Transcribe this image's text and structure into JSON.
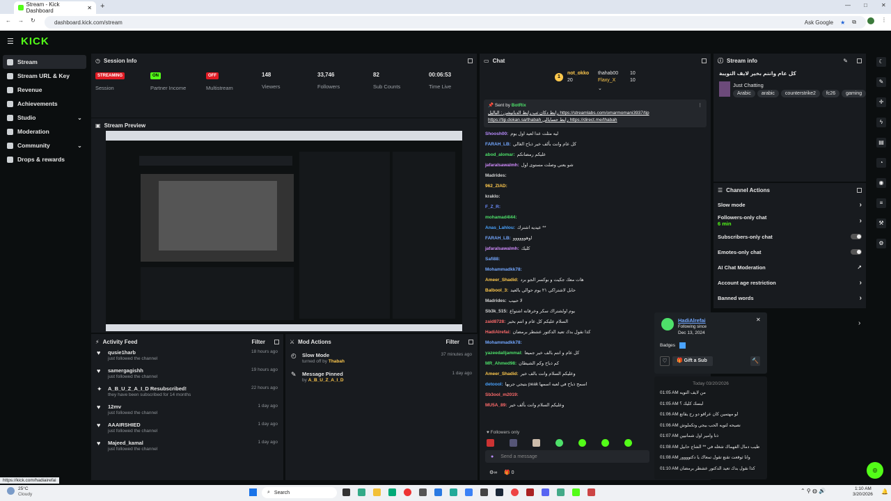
{
  "browser": {
    "tab_title": "Stream - Kick Dashboard",
    "url": "dashboard.kick.com/stream",
    "ask_google": "Ask Google"
  },
  "logo": "KICK",
  "sidebar": {
    "items": [
      {
        "label": "Stream"
      },
      {
        "label": "Stream URL & Key"
      },
      {
        "label": "Revenue"
      },
      {
        "label": "Achievements"
      },
      {
        "label": "Studio"
      },
      {
        "label": "Moderation"
      },
      {
        "label": "Community"
      },
      {
        "label": "Drops & rewards"
      }
    ]
  },
  "session": {
    "title": "Session Info",
    "cells": [
      {
        "pill": "STREAMING",
        "label": "Session"
      },
      {
        "pill": "ON",
        "label": "Partner Income"
      },
      {
        "pill": "OFF",
        "label": "Multistream"
      },
      {
        "num": "148",
        "label": "Viewers"
      },
      {
        "num": "33,746",
        "label": "Followers"
      },
      {
        "num": "82",
        "label": "Sub Counts"
      },
      {
        "num": "00:06:53",
        "label": "Time Live"
      }
    ]
  },
  "preview": {
    "title": "Stream Preview"
  },
  "activity": {
    "title": "Activity Feed",
    "filter": "Filter",
    "items": [
      {
        "user": "qusie1harb",
        "desc": "just followed the channel",
        "time": "18 hours ago"
      },
      {
        "user": "samergagishh",
        "desc": "just followed the channel",
        "time": "19 hours ago"
      },
      {
        "user": "A_B_U_Z_A_I_D Resubscribed!",
        "desc": "they have been subscribed for 14 months",
        "time": "22 hours ago"
      },
      {
        "user": "12mv",
        "desc": "just followed the channel",
        "time": "1 day ago"
      },
      {
        "user": "AAAIRSHIED",
        "desc": "just followed the channel",
        "time": "1 day ago"
      },
      {
        "user": "Majeed_kamal",
        "desc": "just followed the channel",
        "time": "1 day ago"
      }
    ]
  },
  "mod": {
    "title": "Mod Actions",
    "filter": "Filter",
    "items": [
      {
        "title": "Slow Mode",
        "desc": "turned off by",
        "by": "Thabah",
        "time": "37 minutes ago"
      },
      {
        "title": "Message Pinned",
        "desc": "by",
        "by": "A_B_U_Z_A_I_D",
        "time": "1 day ago"
      }
    ]
  },
  "chat": {
    "title": "Chat",
    "top": [
      {
        "name": "not_okko",
        "count": "20"
      },
      {
        "name": "thahab00",
        "count": "10"
      },
      {
        "name": "Flaxy_X",
        "count": "10"
      }
    ],
    "pinned": {
      "by": "Sent by",
      "bot": "BotRix",
      "text": "رابط دكان ثب رابط الدبانيشن : الباليل https://streamlabs.com/omarmomani3937/tip https://tip.dokan.sa/thabah رابط حسابالي https://direct.me/thabah"
    },
    "messages": [
      {
        "u": "Shoosh00:",
        "t": "ليه مثلت عدا لعيد اول يوم",
        "c": "#b98cff"
      },
      {
        "u": "FARAH_LB:",
        "t": "كل عام وانت بألف خير ذباح الغالي",
        "c": "#73a7ff"
      },
      {
        "u": "abod_alomar:",
        "t": "عليكم رمضانكم",
        "c": "#4ee06a"
      },
      {
        "u": "jafaralsawalmh:",
        "t": "شو يعني وصلت مستوى اول",
        "c": "#d28cff"
      },
      {
        "u": "Madrides:",
        "t": "",
        "c": "#d6d6d6"
      },
      {
        "u": "962_ZIAD:",
        "t": "",
        "c": "#ffc94d"
      },
      {
        "u": "kraklo:",
        "t": "",
        "c": "#d6d6d6"
      },
      {
        "u": "F_Z_R:",
        "t": "",
        "c": "#6c8dff"
      },
      {
        "u": "mohamad4l44:",
        "t": "",
        "c": "#4ee06a"
      },
      {
        "u": "Anas_Lahlou:",
        "t": "عيديه اشترك **",
        "c": "#4aa3ff"
      },
      {
        "u": "FARAH_LB:",
        "t": "اوهوووووو",
        "c": "#73a7ff"
      },
      {
        "u": "jafaralsawalmh:",
        "t": "كليك",
        "c": "#d28cff"
      },
      {
        "u": "Safi88:",
        "t": "",
        "c": "#73a7ff"
      },
      {
        "u": "Mohammadkk78:",
        "t": "",
        "c": "#73a7ff"
      },
      {
        "u": "Ameer_Shadid:",
        "t": "هات معك جكيت و بوكسر الجو برد",
        "c": "#ffc94d"
      },
      {
        "u": "Balbool_3:",
        "t": "حابل لاشتراكي ٢١ يوم حوالي بالعيد",
        "c": "#ffc94d"
      },
      {
        "u": "Madrides:",
        "t": "لا حبيب",
        "c": "#d6d6d6"
      },
      {
        "u": "Sb3k_515:",
        "t": "يوم اولشتراك سكر وخرقانه اشتواع",
        "c": "#d6d6d6"
      },
      {
        "u": "zaid8728:",
        "t": "السلام عليكم كل عام و انتم بخير",
        "c": "#ff6b6b"
      },
      {
        "u": "HadiAlrefai:",
        "t": "كذا نقول بدك تعيد الدكتور عشطر برمضان",
        "c": "#ff6b6b"
      },
      {
        "u": "Mohammadkk78:",
        "t": "",
        "c": "#73a7ff"
      },
      {
        "u": "yazeedalljammal:",
        "t": "كل عام و انتم بالف خير جميعا",
        "c": "#4ee06a"
      },
      {
        "u": "MR_Ahmed98:",
        "t": "كم ذباح وكم الشيطان",
        "c": "#4ee06a"
      },
      {
        "u": "Ameer_Shadid:",
        "t": "وعليكم السلام وانت بالف خير",
        "c": "#ffc94d"
      },
      {
        "u": "detoool:",
        "t": "بتيجي جربها peak اسمح ذباح في لعبه اسمها",
        "c": "#4aa3ff"
      },
      {
        "u": "Sb3ool_m2019:",
        "t": "",
        "c": "#ff6b6b"
      },
      {
        "u": "MU5A_89:",
        "t": "وعليكم السلام وانت بألف خير",
        "c": "#ff6b6b"
      }
    ],
    "followers_only": "Followers only",
    "send_placeholder": "Send a message",
    "zero": "0"
  },
  "stream_info": {
    "title": "Stream info",
    "stream_title": "كل عام وانتم بخير لايف التويبة",
    "category": "Just Chatting",
    "tags": [
      "Arabic",
      "arabic",
      "counterstrike2",
      "fc26",
      "gaming"
    ]
  },
  "channel_actions": {
    "title": "Channel Actions",
    "items": [
      {
        "label": "Slow mode",
        "kind": "chev"
      },
      {
        "label": "Followers-only chat",
        "sub": "6 min",
        "kind": "chev"
      },
      {
        "label": "Subscribers-only chat",
        "kind": "toggle"
      },
      {
        "label": "Emotes-only chat",
        "kind": "toggle"
      },
      {
        "label": "AI Chat Moderation",
        "kind": "ext"
      },
      {
        "label": "Account age restriction",
        "kind": "chev"
      },
      {
        "label": "Banned words",
        "kind": "chev"
      }
    ]
  },
  "user_card": {
    "name": "HadiAlrefai",
    "following_since": "Following since",
    "date": "Dec 13, 2024",
    "badges": "Badges",
    "gift": "Gift a Sub",
    "today": "Today 03/20/2026",
    "log": [
      {
        "t": "01:05 AM",
        "m": "من لايف التويه"
      },
      {
        "t": "01:05 AM",
        "m": "لبسك كليك ؟"
      },
      {
        "t": "01:06 AM",
        "m": "لو مهتمين كان عراقو دو رح يقاتع"
      },
      {
        "t": "01:06 AM",
        "m": "نصيحه لتويه الحب بيجي وتكملوش"
      },
      {
        "t": "01:07 AM",
        "m": "ذنا وامير اول شمانيين"
      },
      {
        "t": "01:08 AM",
        "m": "طيب دمال الفهماك شغله في ** الشاج حابيل"
      },
      {
        "t": "01:08 AM",
        "m": "وانا ثوقعت تقنع تقول تمعاك يا دكتوووور"
      },
      {
        "t": "01:10 AM",
        "m": "كذا نقول بدك تعيد الدكتور عشطر برمضان"
      }
    ]
  },
  "status_url": "https://kick.com/hadiairefai",
  "taskbar": {
    "weather_temp": "25°C",
    "weather": "Cloudy",
    "search": "Search",
    "time": "1:10 AM",
    "date": "3/20/2026"
  },
  "colors": {
    "kick_green": "#53fc18",
    "panel": "#181b1f",
    "bg": "#0b0e0f"
  }
}
